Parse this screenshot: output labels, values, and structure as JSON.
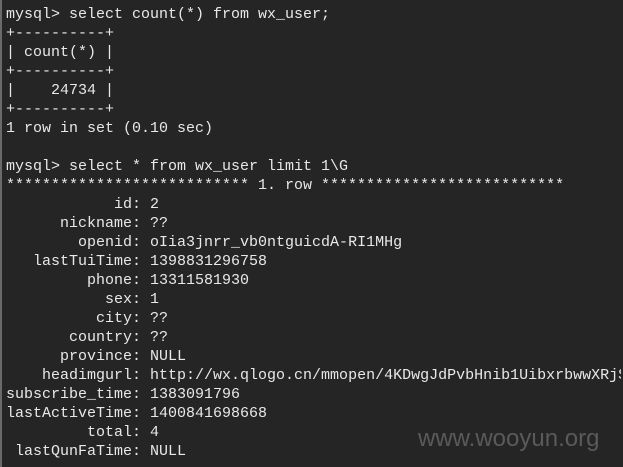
{
  "lines_top": [
    "mysql> select count(*) from wx_user;",
    "+----------+",
    "| count(*) |",
    "+----------+",
    "|    24734 |",
    "+----------+",
    "1 row in set (0.10 sec)",
    "",
    "mysql> select * from wx_user limit 1\\G",
    "*************************** 1. row ***************************"
  ],
  "record": [
    {
      "name": "id",
      "value": "2"
    },
    {
      "name": "nickname",
      "value": "??"
    },
    {
      "name": "openid",
      "value": "oIia3jnrr_vb0ntguicdA-RI1MHg"
    },
    {
      "name": "lastTuiTime",
      "value": "1398831296758"
    },
    {
      "name": "phone",
      "value": "13311581930"
    },
    {
      "name": "sex",
      "value": "1"
    },
    {
      "name": "city",
      "value": "??"
    },
    {
      "name": "country",
      "value": "??"
    },
    {
      "name": "province",
      "value": "NULL"
    },
    {
      "name": "headimgurl",
      "value": "http://wx.qlogo.cn/mmopen/4KDwgJdPvbHnib1UibxrbwwXRjS"
    },
    {
      "name": "subscribe_time",
      "value": "1383091796"
    },
    {
      "name": "lastActiveTime",
      "value": "1400841698668"
    },
    {
      "name": "total",
      "value": "4"
    },
    {
      "name": "lastQunFaTime",
      "value": "NULL"
    }
  ],
  "watermark": "www.wooyun.org"
}
